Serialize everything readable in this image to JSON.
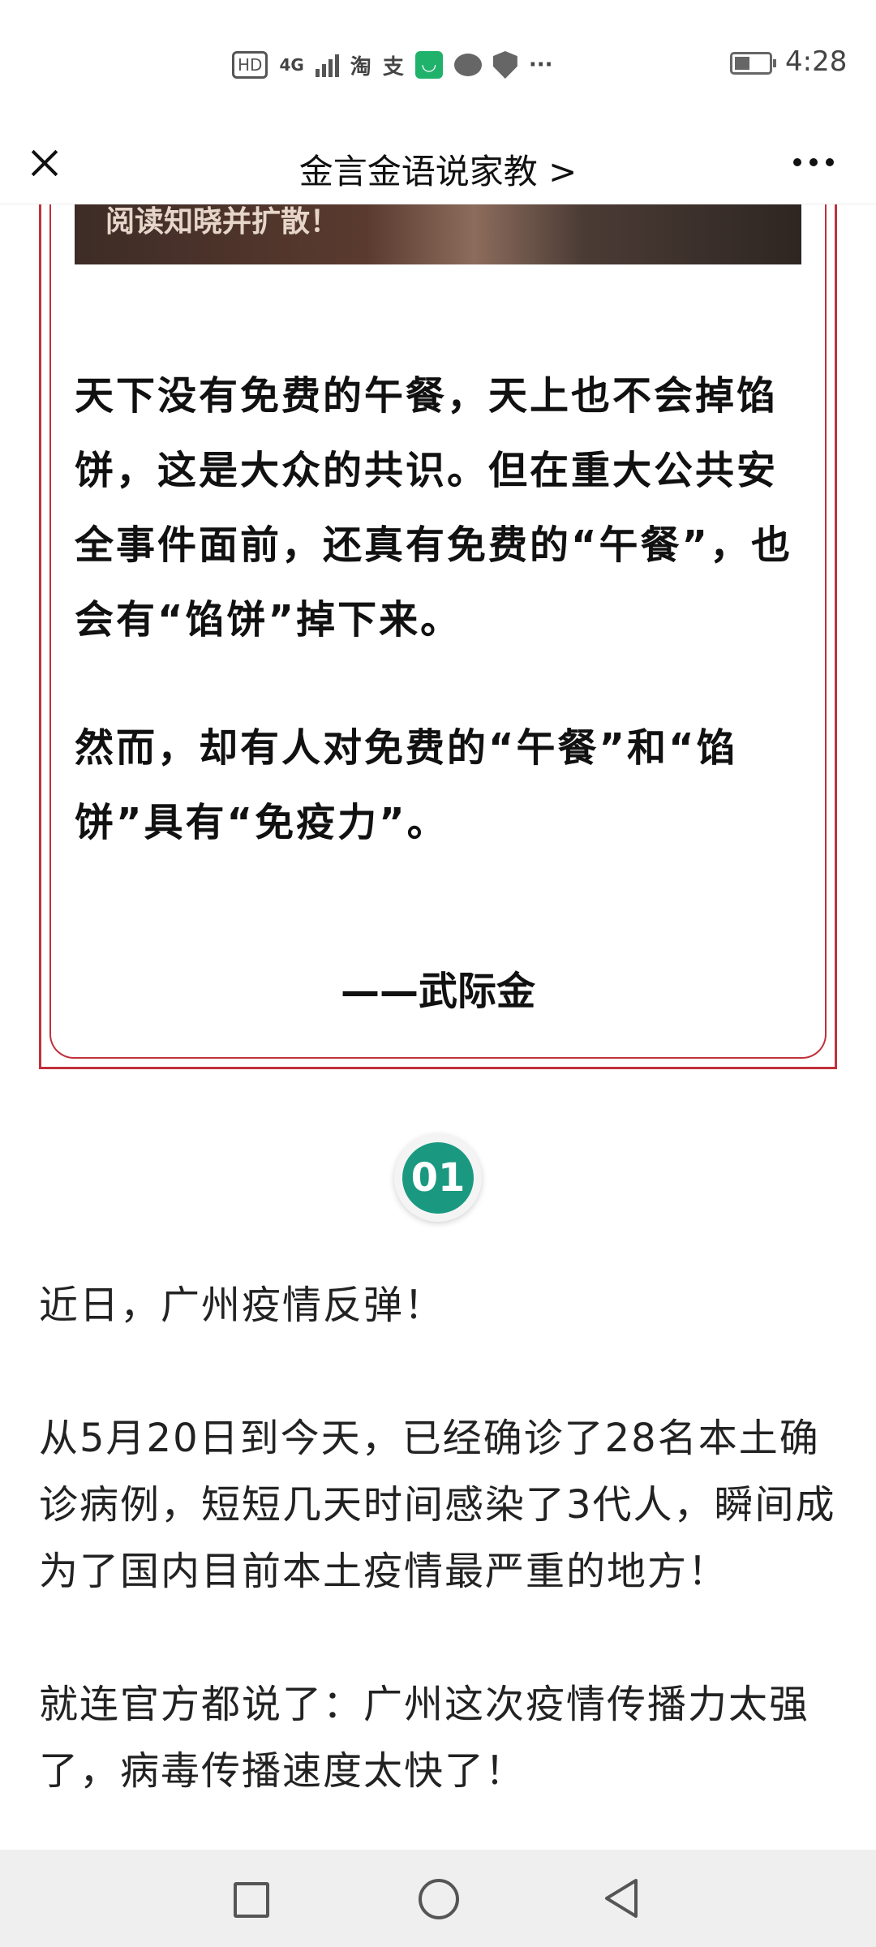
{
  "status_bar": {
    "hd": "HD",
    "network": "4G",
    "time": "4:28",
    "app_icons": [
      "淘",
      "支"
    ]
  },
  "nav": {
    "title": "金言金语说家教"
  },
  "quote_card": {
    "photo_caption": "阅读知晓并扩散！",
    "paragraphs": [
      "天下没有免费的午餐，天上也不会掉馅饼，这是大众的共识。但在重大公共安全事件面前，还真有免费的“午餐”，也会有“馅饼”掉下来。",
      "然而，却有人对免费的“午餐”和“馅饼”具有“免疫力”。"
    ],
    "author": "——武际金"
  },
  "section": {
    "number": "01"
  },
  "article": {
    "paragraphs": [
      "近日，广州疫情反弹！",
      "从5月20日到今天，已经确诊了28名本土确诊病例，短短几天时间感染了3代人，瞬间成为了国内目前本土疫情最严重的地方！",
      "就连官方都说了：广州这次疫情传播力太强了，病毒传播速度太快了！"
    ]
  }
}
